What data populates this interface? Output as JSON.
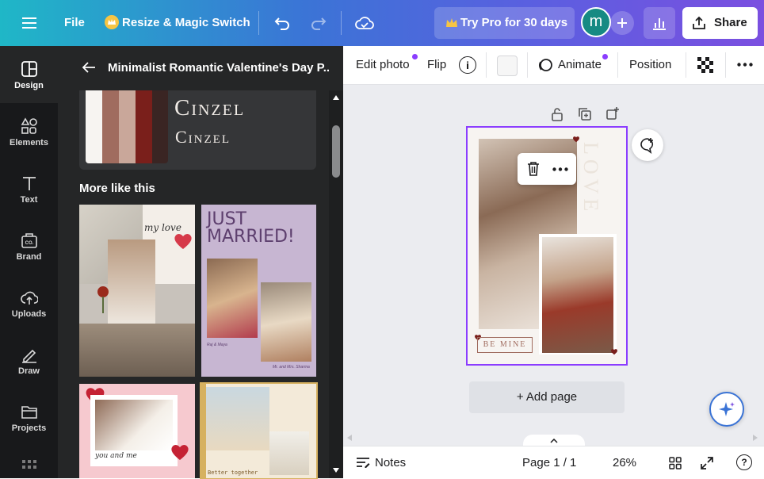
{
  "topbar": {
    "file_label": "File",
    "resize_label": "Resize & Magic Switch",
    "try_pro_label": "Try Pro for 30 days",
    "avatar_initial": "m",
    "share_label": "Share"
  },
  "rail": {
    "items": [
      {
        "label": "Design",
        "icon": "design-icon"
      },
      {
        "label": "Elements",
        "icon": "elements-icon"
      },
      {
        "label": "Text",
        "icon": "text-icon"
      },
      {
        "label": "Brand",
        "icon": "brand-icon"
      },
      {
        "label": "Uploads",
        "icon": "uploads-icon"
      },
      {
        "label": "Draw",
        "icon": "draw-icon"
      },
      {
        "label": "Projects",
        "icon": "projects-icon"
      }
    ]
  },
  "panel": {
    "title": "Minimalist Romantic Valentine's Day P...",
    "font_preview_1": "Cinzel",
    "font_preview_2": "Cinzel",
    "palette": [
      "#f7f4f1",
      "#a06c5f",
      "#c9a79a",
      "#7a1f1b",
      "#3a2523"
    ],
    "more_like_this": "More like this",
    "templates": [
      {
        "caption": "my love"
      },
      {
        "heading": "JUST MARRIED!",
        "names": "Raj & Maya",
        "sub": "Mr. and Mrs. Sharma"
      },
      {
        "caption": "you and me"
      },
      {
        "caption": "Better together"
      }
    ]
  },
  "context_toolbar": {
    "edit_photo": "Edit photo",
    "flip": "Flip",
    "animate": "Animate",
    "position": "Position"
  },
  "design": {
    "vertical_word": "LOVE",
    "be_mine": "BE MINE"
  },
  "canvas": {
    "add_page": "+ Add page"
  },
  "bottombar": {
    "notes": "Notes",
    "page_indicator": "Page 1 / 1",
    "zoom": "26%"
  },
  "colors": {
    "accent_purple": "#8b3dff",
    "rail_bg": "#18191b",
    "panel_bg": "#252627",
    "canvas_bg": "#ebecf0"
  }
}
